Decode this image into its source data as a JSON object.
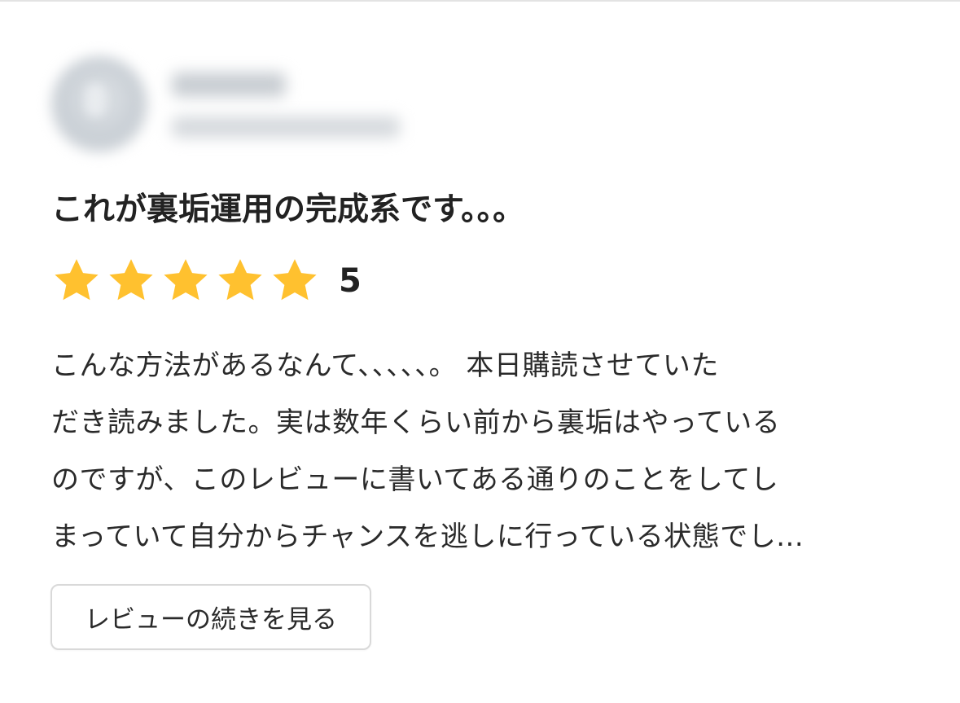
{
  "review": {
    "title": "これが裏垢運用の完成系です。。。",
    "rating": {
      "stars": 5,
      "max": 5,
      "label": "5",
      "star_color": "#ffc12f"
    },
    "body_lines": [
      "こんな方法があるなんて、、、、、。 本日購読させていた",
      "だき読みました。実は数年くらい前から裏垢はやっている",
      "のですが、このレビューに書いてある通りのことをしてし",
      "まっていて自分からチャンスを逃しに行っている状態でし..."
    ],
    "more_button_label": "レビューの続きを見る"
  }
}
